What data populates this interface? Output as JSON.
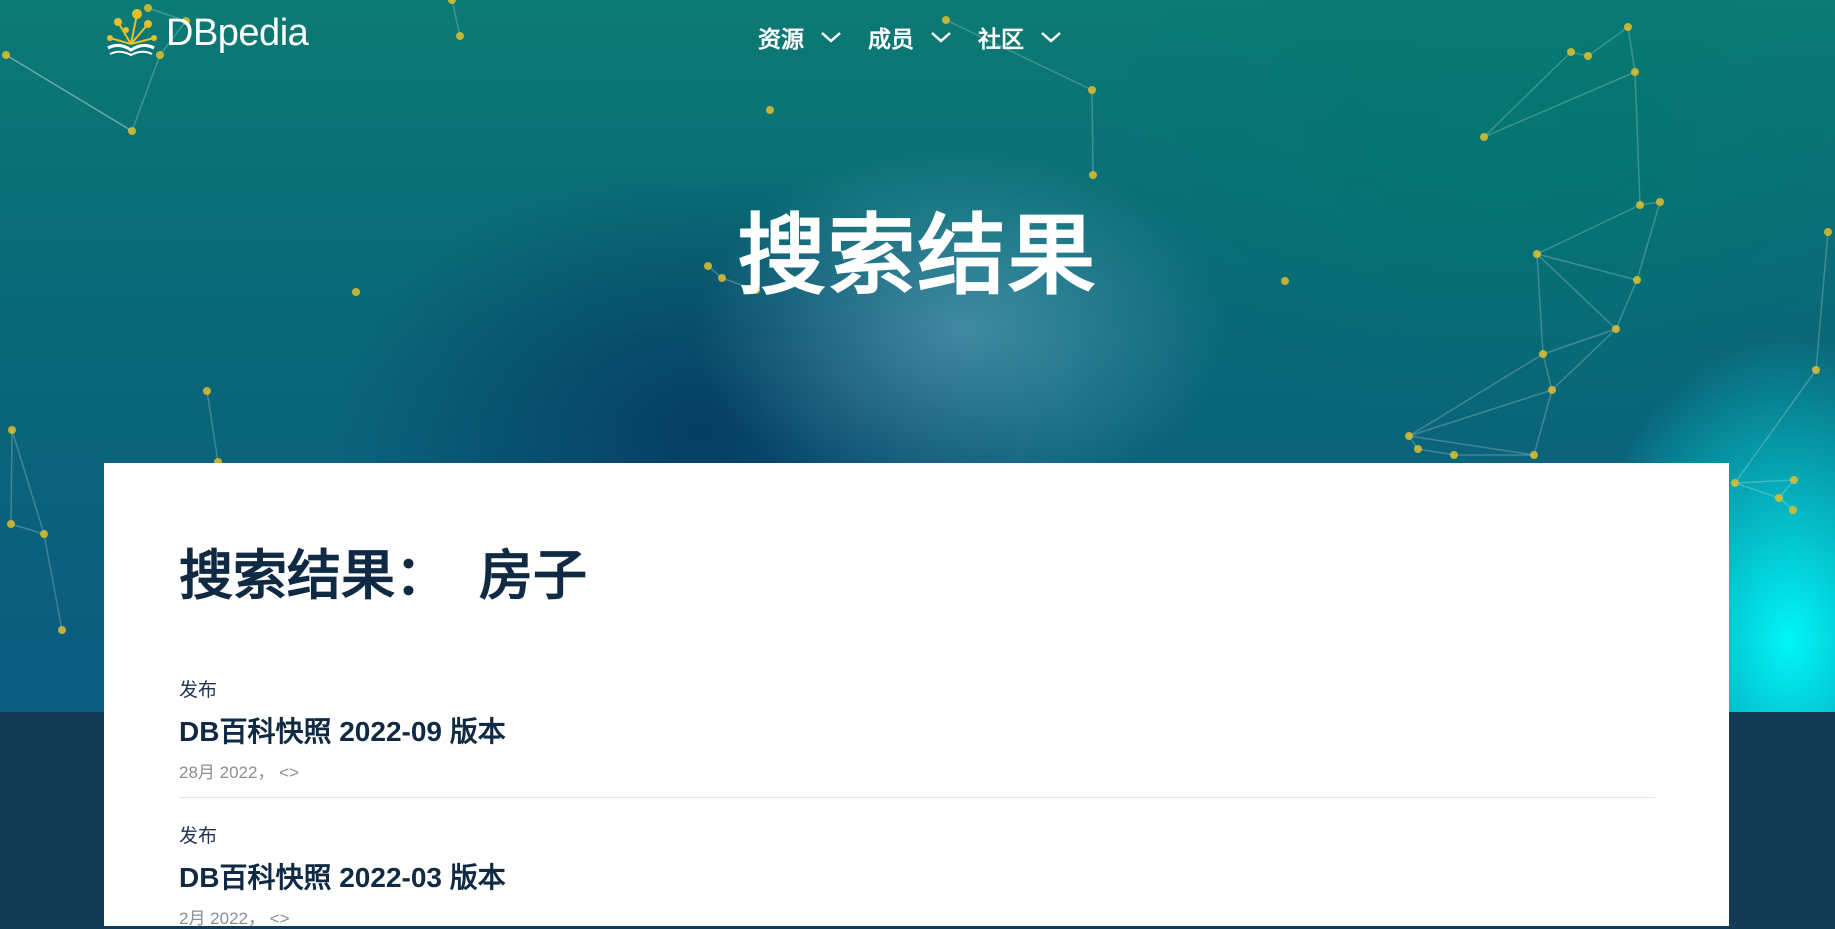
{
  "brand": {
    "name": "DBpedia"
  },
  "nav": {
    "items": [
      {
        "label": "资源"
      },
      {
        "label": "成员"
      },
      {
        "label": "社区"
      }
    ]
  },
  "hero": {
    "title": "搜索结果"
  },
  "search": {
    "heading": "搜索结果：",
    "term": "房子"
  },
  "results": [
    {
      "category": "发布",
      "title": "DB百科快照 2022-09 版本",
      "meta": "28月 2022， <>"
    },
    {
      "category": "发布",
      "title": "DB百科快照 2022-03 版本",
      "meta": "2月 2022， <>"
    }
  ],
  "colors": {
    "accent_dot": "#e0c02a",
    "heading": "#112a44",
    "footer_band": "#133b55"
  },
  "icons": [
    "dbpedia-logo-icon",
    "chevron-down-icon"
  ]
}
